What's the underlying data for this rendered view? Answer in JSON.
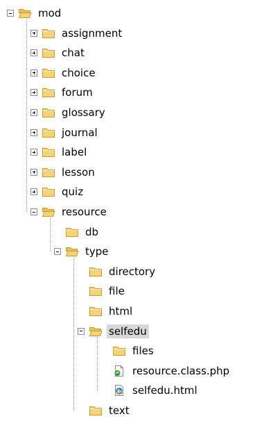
{
  "tree": [
    {
      "label": "mod",
      "depth": 0,
      "expander": "minus",
      "icon": "folder-open-icon"
    },
    {
      "label": "assignment",
      "depth": 1,
      "expander": "plus",
      "icon": "folder-icon"
    },
    {
      "label": "chat",
      "depth": 1,
      "expander": "plus",
      "icon": "folder-icon"
    },
    {
      "label": "choice",
      "depth": 1,
      "expander": "plus",
      "icon": "folder-icon"
    },
    {
      "label": "forum",
      "depth": 1,
      "expander": "plus",
      "icon": "folder-icon"
    },
    {
      "label": "glossary",
      "depth": 1,
      "expander": "plus",
      "icon": "folder-icon"
    },
    {
      "label": "journal",
      "depth": 1,
      "expander": "plus",
      "icon": "folder-icon"
    },
    {
      "label": "label",
      "depth": 1,
      "expander": "plus",
      "icon": "folder-icon"
    },
    {
      "label": "lesson",
      "depth": 1,
      "expander": "plus",
      "icon": "folder-icon"
    },
    {
      "label": "quiz",
      "depth": 1,
      "expander": "plus",
      "icon": "folder-icon"
    },
    {
      "label": "resource",
      "depth": 1,
      "expander": "minus",
      "icon": "folder-open-icon"
    },
    {
      "label": "db",
      "depth": 2,
      "expander": "none",
      "icon": "folder-icon"
    },
    {
      "label": "type",
      "depth": 2,
      "expander": "minus",
      "icon": "folder-open-icon"
    },
    {
      "label": "directory",
      "depth": 3,
      "expander": "none",
      "icon": "folder-icon"
    },
    {
      "label": "file",
      "depth": 3,
      "expander": "none",
      "icon": "folder-icon"
    },
    {
      "label": "html",
      "depth": 3,
      "expander": "none",
      "icon": "folder-icon"
    },
    {
      "label": "selfedu",
      "depth": 3,
      "expander": "minus",
      "icon": "folder-open-icon",
      "selected": true
    },
    {
      "label": "files",
      "depth": 4,
      "expander": "none",
      "icon": "folder-icon"
    },
    {
      "label": "resource.class.php",
      "depth": 4,
      "expander": "none",
      "icon": "php-file-icon"
    },
    {
      "label": "selfedu.html",
      "depth": 4,
      "expander": "none",
      "icon": "html-file-icon"
    },
    {
      "label": "text",
      "depth": 3,
      "expander": "none",
      "icon": "folder-icon"
    }
  ],
  "colors": {
    "folder": "#f5d37a",
    "folder_edge": "#c89a2c",
    "selection": "#d8d8d8",
    "tree_line": "#a0a0a0"
  }
}
